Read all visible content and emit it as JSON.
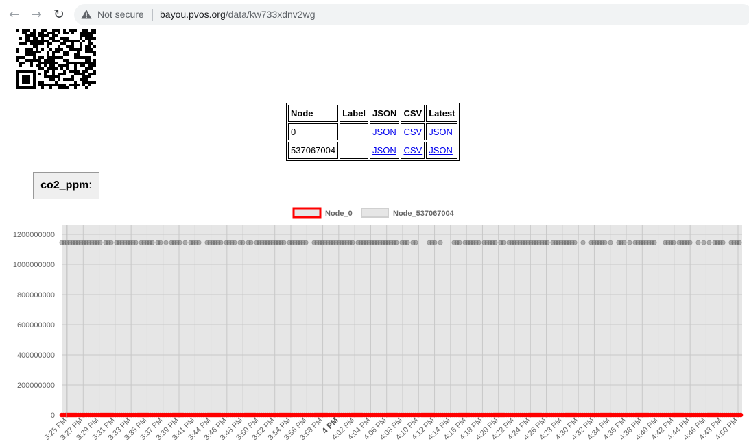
{
  "browser": {
    "security_label": "Not secure",
    "url_host": "bayou.pvos.org",
    "url_path": "/data/kw733xdnv2wg"
  },
  "table": {
    "headers": [
      "Node",
      "Label",
      "JSON",
      "CSV",
      "Latest"
    ],
    "rows": [
      {
        "node": "0",
        "label": "",
        "json": "JSON",
        "csv": "CSV",
        "latest": "JSON"
      },
      {
        "node": "537067004",
        "label": "",
        "json": "JSON",
        "csv": "CSV",
        "latest": "JSON"
      }
    ]
  },
  "field": {
    "name": "co2_ppm",
    "suffix": ":"
  },
  "colors": {
    "node0": "#ff0000",
    "node1": "#444444",
    "plot_bg": "#e6e6e6"
  },
  "chart_data": {
    "type": "scatter",
    "legend_position": "top",
    "grid": true,
    "ylim": [
      0,
      1200000000
    ],
    "y_ticks": [
      "0",
      "200000000",
      "400000000",
      "600000000",
      "800000000",
      "1000000000",
      "1200000000"
    ],
    "x_tick_labels": [
      "3:25 PM",
      "3:27 PM",
      "3:29 PM",
      "3:31 PM",
      "3:33 PM",
      "3:35 PM",
      "3:37 PM",
      "3:39 PM",
      "3:41 PM",
      "3:44 PM",
      "3:46 PM",
      "3:48 PM",
      "3:50 PM",
      "3:52 PM",
      "3:54 PM",
      "3:56 PM",
      "3:58 PM",
      "4 PM",
      "4:02 PM",
      "4:04 PM",
      "4:06 PM",
      "4:08 PM",
      "4:10 PM",
      "4:12 PM",
      "4:14 PM",
      "4:16 PM",
      "4:18 PM",
      "4:20 PM",
      "4:22 PM",
      "4:24 PM",
      "4:26 PM",
      "4:28 PM",
      "4:30 PM",
      "4:32 PM",
      "4:34 PM",
      "4:36 PM",
      "4:38 PM",
      "4:40 PM",
      "4:42 PM",
      "4:44 PM",
      "4:46 PM",
      "4:48 PM",
      "4:50 PM"
    ],
    "x_bold_label": "4 PM",
    "series": [
      {
        "name": "Node_0",
        "constant_value": 0
      },
      {
        "name": "Node_537067004",
        "constant_value": 1145000000
      }
    ]
  }
}
